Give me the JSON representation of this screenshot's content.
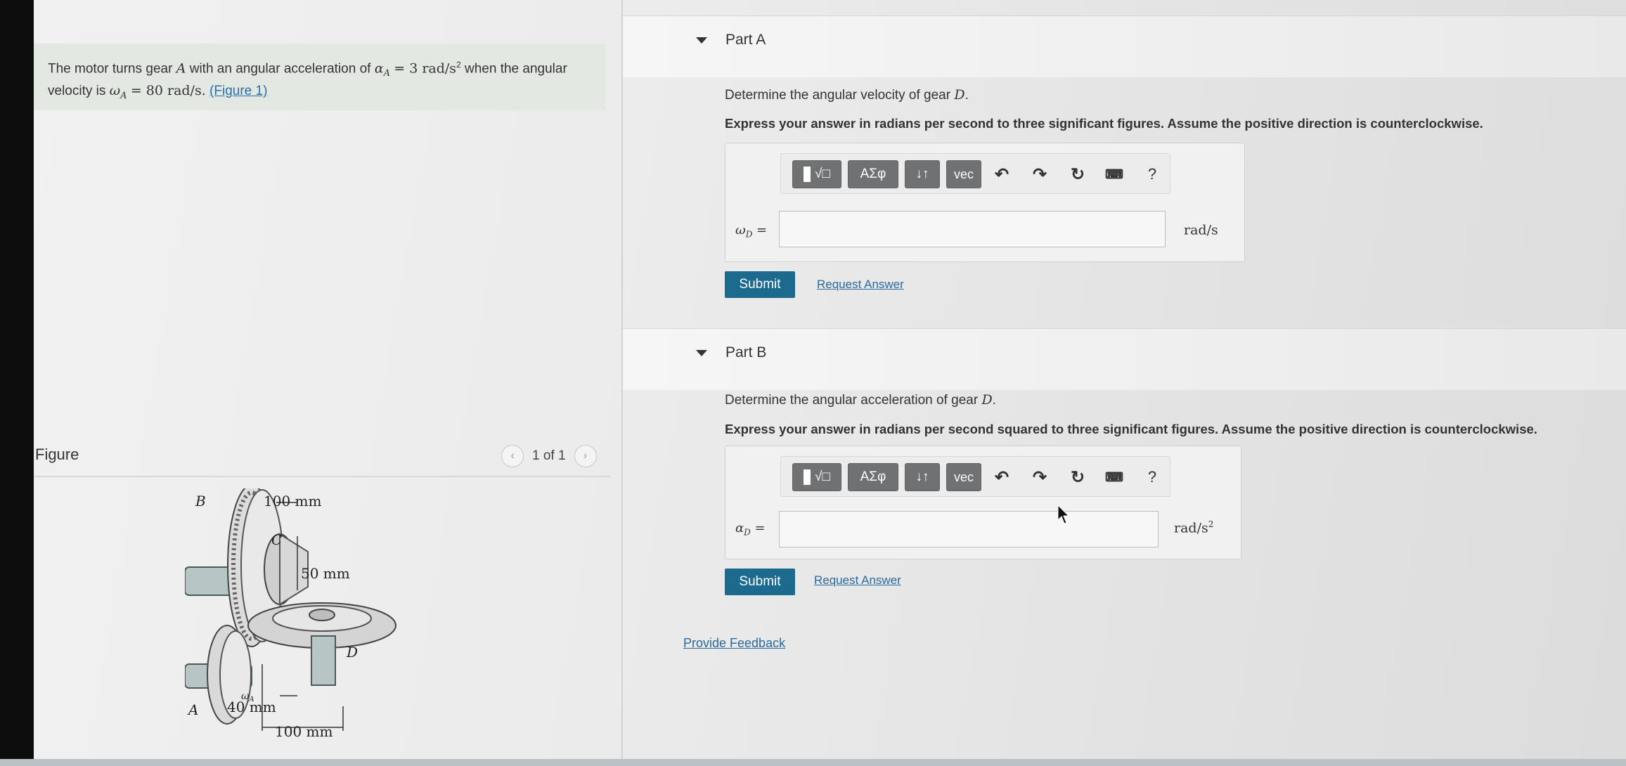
{
  "problem": {
    "text_before_alpha": "The motor turns gear",
    "gear_a": "A",
    "text_mid1": "with an angular acceleration of",
    "alpha_expr": "α",
    "alpha_sub": "A",
    "alpha_val": "= 3 rad/s",
    "alpha_exp": "2",
    "text_mid2": "when the angular velocity is",
    "omega_expr": "ω",
    "omega_sub": "A",
    "omega_val": "= 80 rad/s.",
    "figure_link": "(Figure 1)"
  },
  "figure": {
    "label": "Figure",
    "counter": "1 of 1",
    "prev_icon": "chevron-left-icon",
    "next_icon": "chevron-right-icon",
    "dims": {
      "d100_top": "100 mm",
      "d50": "50 mm",
      "d40": "40 mm",
      "d100_bottom": "100 mm",
      "gear_b": "B",
      "gear_c": "C",
      "gear_d": "D",
      "gear_a": "A",
      "omega": "ω",
      "omega_sub": "A"
    }
  },
  "parts": [
    {
      "title": "Part A",
      "question_prefix": "Determine the angular velocity of gear",
      "question_var": "D",
      "question_suffix": ".",
      "instructions": "Express your answer in radians per second to three significant figures. Assume the positive direction is counterclockwise.",
      "toolbar": {
        "templates_label": "√□",
        "greek_label": "ΑΣφ",
        "arrows_label": "↓↑",
        "vec_label": "vec",
        "help_label": "?"
      },
      "variable_symbol": "ω",
      "variable_sub": "D",
      "variable_eq": " =",
      "input_value": "",
      "unit": "rad/s",
      "unit_exp": "",
      "submit_label": "Submit",
      "request_label": "Request Answer"
    },
    {
      "title": "Part B",
      "question_prefix": "Determine the angular acceleration of gear",
      "question_var": "D",
      "question_suffix": ".",
      "instructions": "Express your answer in radians per second squared to three significant figures. Assume the positive direction is counterclockwise.",
      "toolbar": {
        "templates_label": "√□",
        "greek_label": "ΑΣφ",
        "arrows_label": "↓↑",
        "vec_label": "vec",
        "help_label": "?"
      },
      "variable_symbol": "α",
      "variable_sub": "D",
      "variable_eq": " =",
      "input_value": "",
      "unit": "rad/s",
      "unit_exp": "2",
      "submit_label": "Submit",
      "request_label": "Request Answer"
    }
  ],
  "feedback_label": "Provide Feedback",
  "colors": {
    "submit": "#1d6a8f",
    "link": "#2b6a9a",
    "prompt_bg": "#e3e8e3",
    "toolbar_btn": "#6f7173"
  }
}
